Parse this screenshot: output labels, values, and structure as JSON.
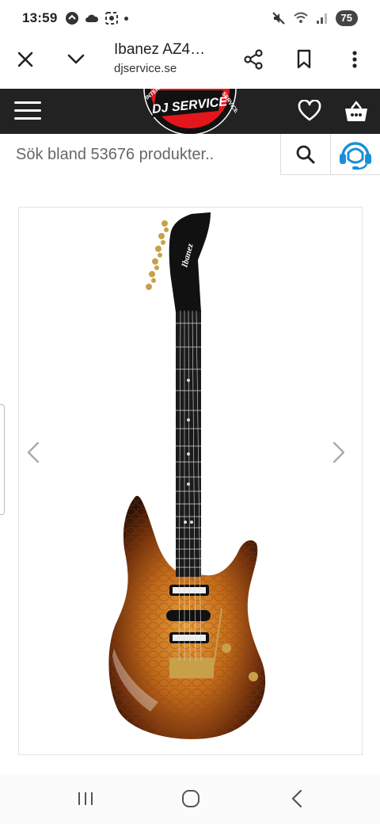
{
  "status_bar": {
    "time": "13:59",
    "battery": "75"
  },
  "tab_bar": {
    "title": "Ibanez AZ4…",
    "url": "djservice.se"
  },
  "site_header": {
    "logo_text": "DJ SERVICE",
    "logo_ring_left": "INTERNATIONAL",
    "logo_ring_right": "SERVICE"
  },
  "search": {
    "placeholder": "Sök bland 53676 produkter.."
  },
  "product": {
    "headstock_brand": "Ibanez"
  },
  "colors": {
    "header_bg": "#222222",
    "accent_blue": "#1a8fd6",
    "logo_red": "#e3161b"
  }
}
